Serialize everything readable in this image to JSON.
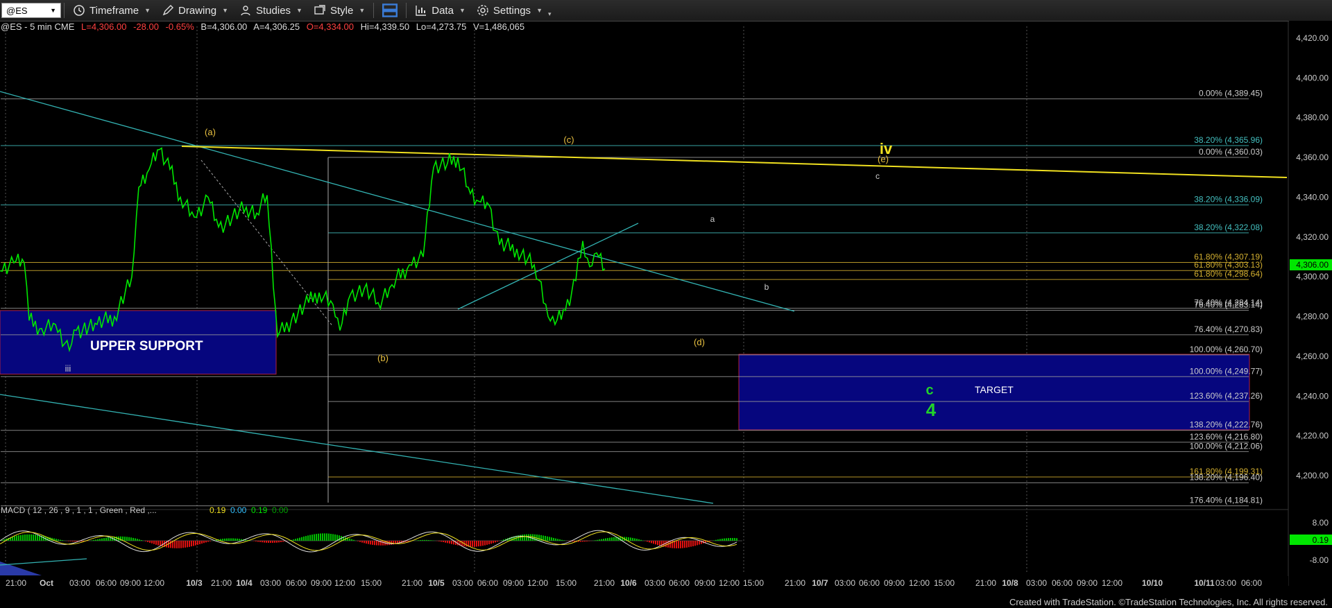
{
  "toolbar": {
    "symbol": "@ES",
    "items": [
      {
        "key": "timeframe",
        "label": "Timeframe",
        "icon": "clock-icon"
      },
      {
        "key": "drawing",
        "label": "Drawing",
        "icon": "pencil-icon"
      },
      {
        "key": "studies",
        "label": "Studies",
        "icon": "person-icon"
      },
      {
        "key": "style",
        "label": "Style",
        "icon": "style-icon"
      },
      {
        "key": "layout",
        "label": "",
        "icon": "layout-icon"
      },
      {
        "key": "data",
        "label": "Data",
        "icon": "bar-chart-icon"
      },
      {
        "key": "settings",
        "label": "Settings",
        "icon": "gear-icon"
      }
    ]
  },
  "infobar": {
    "symbol": "@ES - 5 min  CME",
    "last": "L=4,306.00",
    "change": "-28.00",
    "pct": "-0.65%",
    "bid": "B=4,306.00",
    "ask": "A=4,306.25",
    "open": "O=4,334.00",
    "high": "Hi=4,339.50",
    "low": "Lo=4,273.75",
    "volume": "V=1,486,065"
  },
  "credit": "Created with TradeStation. ©TradeStation Technologies, Inc. All rights reserved.",
  "colors": {
    "price": "#00e600",
    "accent_yellow": "#f0e020",
    "trend": "#33b3b3",
    "box": "#0a0a8a",
    "last_tag": "#00e600"
  },
  "chart_data": {
    "type": "line",
    "title": "@ES - 5 min CME",
    "ylim": [
      4177,
      4424
    ],
    "price_ticks": [
      "4,420.00",
      "4,400.00",
      "4,380.00",
      "4,360.00",
      "4,340.00",
      "4,320.00",
      "4,300.00",
      "4,280.00",
      "4,260.00",
      "4,240.00",
      "4,220.00",
      "4,200.00"
    ],
    "last_price": "4,306.00",
    "x_ticks": [
      "21:00",
      "Oct",
      "03:00",
      "06:00",
      "09:00",
      "12:00",
      "10/3",
      "21:00",
      "10/4",
      "03:00",
      "06:00",
      "09:00",
      "12:00",
      "15:00",
      "21:00",
      "10/5",
      "03:00",
      "06:00",
      "09:00",
      "12:00",
      "15:00",
      "21:00",
      "10/6",
      "03:00",
      "06:00",
      "09:00",
      "12:00",
      "15:00",
      "21:00",
      "10/7",
      "03:00",
      "06:00",
      "09:00",
      "12:00",
      "15:00",
      "21:00",
      "10/8",
      "03:00",
      "06:00",
      "09:00",
      "12:00",
      "10/10",
      "10/11",
      "03:00",
      "06:00"
    ],
    "price_path": [
      [
        0,
        4303
      ],
      [
        20,
        4307
      ],
      [
        35,
        4307
      ],
      [
        42,
        4278
      ],
      [
        60,
        4274
      ],
      [
        80,
        4276
      ],
      [
        100,
        4263
      ],
      [
        110,
        4273
      ],
      [
        140,
        4276
      ],
      [
        165,
        4280
      ],
      [
        190,
        4300
      ],
      [
        200,
        4345
      ],
      [
        215,
        4354
      ],
      [
        230,
        4364
      ],
      [
        245,
        4354
      ],
      [
        260,
        4340
      ],
      [
        280,
        4330
      ],
      [
        300,
        4340
      ],
      [
        315,
        4325
      ],
      [
        335,
        4330
      ],
      [
        355,
        4335
      ],
      [
        370,
        4332
      ],
      [
        385,
        4341
      ],
      [
        400,
        4270
      ],
      [
        420,
        4278
      ],
      [
        445,
        4287
      ],
      [
        460,
        4292
      ],
      [
        480,
        4286
      ],
      [
        490,
        4273
      ],
      [
        505,
        4291
      ],
      [
        525,
        4294
      ],
      [
        545,
        4287
      ],
      [
        565,
        4296
      ],
      [
        590,
        4306
      ],
      [
        610,
        4310
      ],
      [
        625,
        4355
      ],
      [
        645,
        4357
      ],
      [
        660,
        4360
      ],
      [
        675,
        4345
      ],
      [
        690,
        4338
      ],
      [
        705,
        4336
      ],
      [
        720,
        4316
      ],
      [
        745,
        4314
      ],
      [
        770,
        4306
      ],
      [
        790,
        4280
      ],
      [
        800,
        4276
      ],
      [
        815,
        4283
      ],
      [
        830,
        4298
      ],
      [
        840,
        4318
      ],
      [
        850,
        4305
      ],
      [
        860,
        4312
      ],
      [
        872,
        4304
      ]
    ],
    "fib_levels": [
      {
        "label": "0.00% (4,389.45)",
        "value": 4389.45
      },
      {
        "label": "38.20% (4,365.96)",
        "value": 4365.96
      },
      {
        "label": "0.00% (4,360.03)",
        "value": 4360.03
      },
      {
        "label": "38.20% (4,336.09)",
        "value": 4336.09
      },
      {
        "label": "38.20% (4,322.08)",
        "value": 4322.08
      },
      {
        "label": "61.80% (4,307.19)",
        "value": 4307.19
      },
      {
        "label": "61.80% (4,303.13)",
        "value": 4303.13
      },
      {
        "label": "61.80% (4,298.64)",
        "value": 4298.64
      },
      {
        "label": "76.40% (4,284.14)",
        "value": 4284.14
      },
      {
        "label": "76.40% (4,283.14)",
        "value": 4283.14
      },
      {
        "label": "76.40% (4,270.83)",
        "value": 4270.83
      },
      {
        "label": "100.00% (4,260.70)",
        "value": 4260.7
      },
      {
        "label": "100.00% (4,249.77)",
        "value": 4249.77
      },
      {
        "label": "123.60% (4,237.26)",
        "value": 4237.26
      },
      {
        "label": "138.20% (4,222.76)",
        "value": 4222.76
      },
      {
        "label": "123.60% (4,216.80)",
        "value": 4216.8
      },
      {
        "label": "100.00% (4,212.06)",
        "value": 4212.06
      },
      {
        "label": "161.80% (4,199.31)",
        "value": 4199.31
      },
      {
        "label": "138.20% (4,196.40)",
        "value": 4196.4
      },
      {
        "label": "176.40% (4,184.81)",
        "value": 4184.81
      }
    ],
    "wave_labels": [
      {
        "text": "(a)",
        "color": "#e8c040"
      },
      {
        "text": "(b)",
        "color": "#e8c040"
      },
      {
        "text": "(c)",
        "color": "#e8c040"
      },
      {
        "text": "(d)",
        "color": "#e8c040"
      },
      {
        "text": "(e)",
        "color": "#e8c040"
      },
      {
        "text": "iv",
        "color": "#f0e020"
      },
      {
        "text": "c",
        "color": "#cccccc"
      },
      {
        "text": "a",
        "color": "#cccccc"
      },
      {
        "text": "b",
        "color": "#cccccc"
      },
      {
        "text": "iii",
        "color": "#cccccc"
      },
      {
        "text": "c",
        "color": "#22d22a"
      },
      {
        "text": "4",
        "color": "#22d22a"
      }
    ],
    "zones": [
      {
        "label": "UPPER SUPPORT",
        "top": 4283,
        "bottom": 4251
      },
      {
        "label": "TARGET",
        "top": 4261,
        "bottom": 4223
      }
    ],
    "macd": {
      "title": "MACD ( 12 , 26 , 9 , 1 , 1 , Green , Red ,...",
      "values": [
        "0.19",
        "0.00",
        "0.19",
        "0.00"
      ],
      "ticks": [
        "8.00",
        "-8.00"
      ],
      "last": "0.19"
    }
  }
}
